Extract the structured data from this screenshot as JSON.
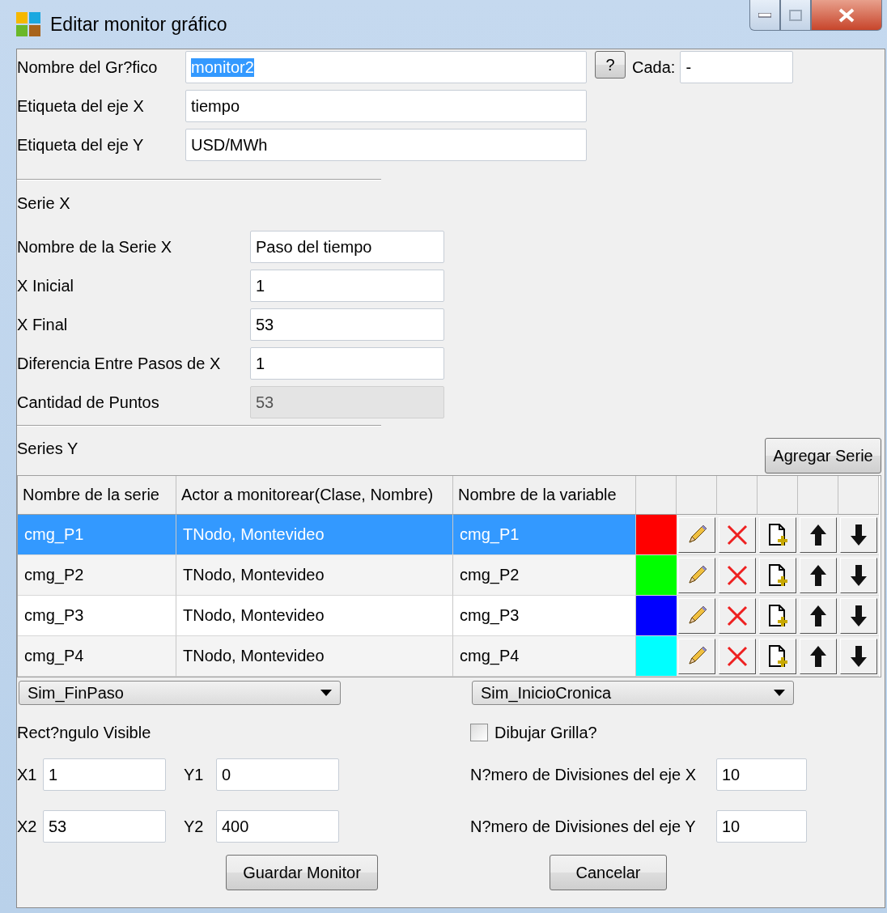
{
  "window": {
    "title": "Editar monitor gráfico"
  },
  "fields": [
    {
      "label": "Nombre del Gr?fico",
      "value": "monitor2",
      "selected": true
    },
    {
      "label": "Etiqueta del eje X",
      "value": "tiempo",
      "selected": false
    },
    {
      "label": "Etiqueta del eje Y",
      "value": "USD/MWh",
      "selected": false
    }
  ],
  "help_button": "?",
  "cada": {
    "label": "Cada:",
    "value": "-"
  },
  "serie_x": {
    "title": "Serie X",
    "fields": [
      {
        "label": "Nombre de la Serie X",
        "value": "Paso del tiempo",
        "disabled": false
      },
      {
        "label": "X Inicial",
        "value": "1",
        "disabled": false
      },
      {
        "label": "X Final",
        "value": "53",
        "disabled": false
      },
      {
        "label": "Diferencia Entre Pasos de X",
        "value": "1",
        "disabled": false
      },
      {
        "label": "Cantidad de Puntos",
        "value": "53",
        "disabled": true
      }
    ]
  },
  "series_y": {
    "title": "Series Y",
    "add_button": "Agregar Serie",
    "columns": [
      "Nombre de la serie",
      "Actor a monitorear(Clase, Nombre)",
      "Nombre de la variable"
    ],
    "rows": [
      {
        "name": "cmg_P1",
        "actor": "TNodo, Montevideo",
        "variable": "cmg_P1",
        "color": "#ff0000",
        "selected": true
      },
      {
        "name": "cmg_P2",
        "actor": "TNodo, Montevideo",
        "variable": "cmg_P2",
        "color": "#00ff00",
        "selected": false
      },
      {
        "name": "cmg_P3",
        "actor": "TNodo, Montevideo",
        "variable": "cmg_P3",
        "color": "#0000ff",
        "selected": false
      },
      {
        "name": "cmg_P4",
        "actor": "TNodo, Montevideo",
        "variable": "cmg_P4",
        "color": "#00ffff",
        "selected": false
      }
    ]
  },
  "dropdowns": [
    {
      "value": "Sim_FinPaso"
    },
    {
      "value": "Sim_InicioCronica"
    }
  ],
  "rect": {
    "title": "Rect?ngulo Visible",
    "fields": [
      {
        "label": "X1",
        "value": "1"
      },
      {
        "label": "Y1",
        "value": "0"
      },
      {
        "label": "X2",
        "value": "53"
      },
      {
        "label": "Y2",
        "value": "400"
      }
    ]
  },
  "grid": {
    "label": "Dibujar Grilla?",
    "checked": false
  },
  "divisions": [
    {
      "label": "N?mero de Divisiones del eje X",
      "value": "10"
    },
    {
      "label": "N?mero de Divisiones del eje Y",
      "value": "10"
    }
  ],
  "buttons": [
    "Guardar Monitor",
    "Cancelar"
  ]
}
